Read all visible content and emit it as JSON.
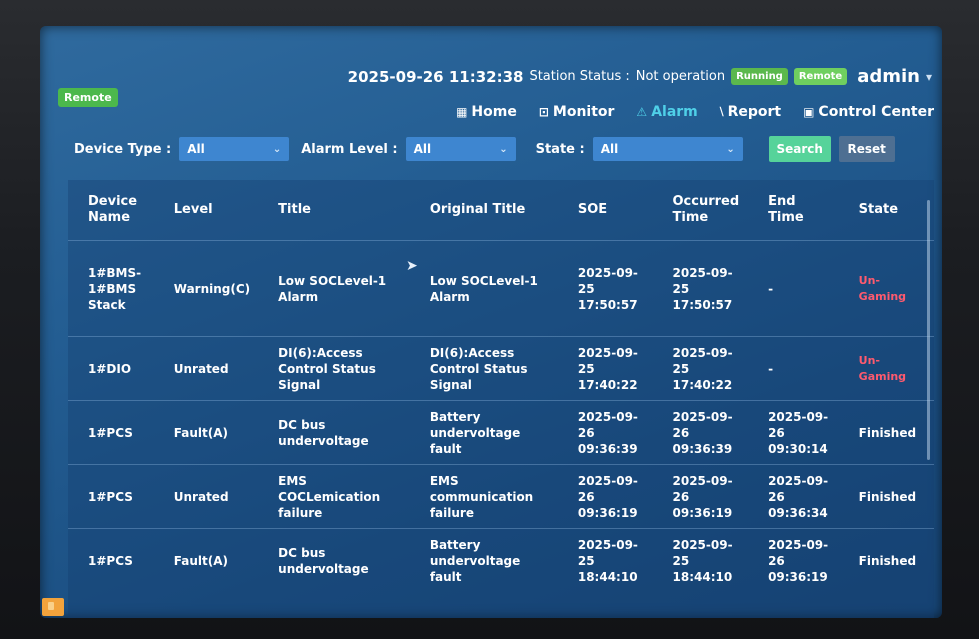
{
  "header": {
    "datetime": "2025-09-26 11:32:38",
    "station_status_label": "Station Status :",
    "station_status_value": "Not operation",
    "running_badge": "Running",
    "remote_badge": "Remote",
    "user": "admin"
  },
  "left_badge": "Remote",
  "nav": [
    {
      "label": "Home",
      "icon": "home-icon"
    },
    {
      "label": "Monitor",
      "icon": "monitor-icon"
    },
    {
      "label": "Alarm",
      "icon": "alarm-icon",
      "active": true
    },
    {
      "label": "Report",
      "icon": "report-icon"
    },
    {
      "label": "Control Center",
      "icon": "control-center-icon"
    }
  ],
  "filters": {
    "device_type_label": "Device Type :",
    "device_type_value": "All",
    "alarm_level_label": "Alarm Level :",
    "alarm_level_value": "All",
    "state_label": "State :",
    "state_value": "All",
    "search_label": "Search",
    "reset_label": "Reset"
  },
  "table": {
    "columns": [
      "Device Name",
      "Level",
      "Title",
      "Original Title",
      "SOE",
      "Occurred Time",
      "End Time",
      "State"
    ],
    "rows": [
      [
        "1#BMS-1#BMS Stack",
        "Warning(C)",
        "Low SOCLevel-1 Alarm",
        "Low SOCLevel-1 Alarm",
        "2025-09-25 17:50:57",
        "2025-09-25 17:50:57",
        "-",
        "Un-Gaming"
      ],
      [
        "1#DIO",
        "Unrated",
        "DI(6):Access Control Status Signal",
        "DI(6):Access Control Status Signal",
        "2025-09-25 17:40:22",
        "2025-09-25 17:40:22",
        "-",
        "Un-Gaming"
      ],
      [
        "1#PCS",
        "Fault(A)",
        "DC bus undervoltage",
        "Battery undervoltage fault",
        "2025-09-26 09:36:39",
        "2025-09-26 09:36:39",
        "2025-09-26 09:30:14",
        "Finished"
      ],
      [
        "1#PCS",
        "Unrated",
        "EMS COCLemication failure",
        "EMS communication failure",
        "2025-09-26 09:36:19",
        "2025-09-26 09:36:19",
        "2025-09-26 09:36:34",
        "Finished"
      ],
      [
        "1#PCS",
        "Fault(A)",
        "DC bus undervoltage",
        "Battery undervoltage fault",
        "2025-09-25 18:44:10",
        "2025-09-25 18:44:10",
        "2025-09-26 09:36:19",
        "Finished"
      ]
    ]
  },
  "colors": {
    "accent": "#4fd0e8",
    "screen": "#235d92",
    "search": "#56d39a",
    "running": "#5bb84d",
    "state_unfinished": "#ff5a6e"
  }
}
